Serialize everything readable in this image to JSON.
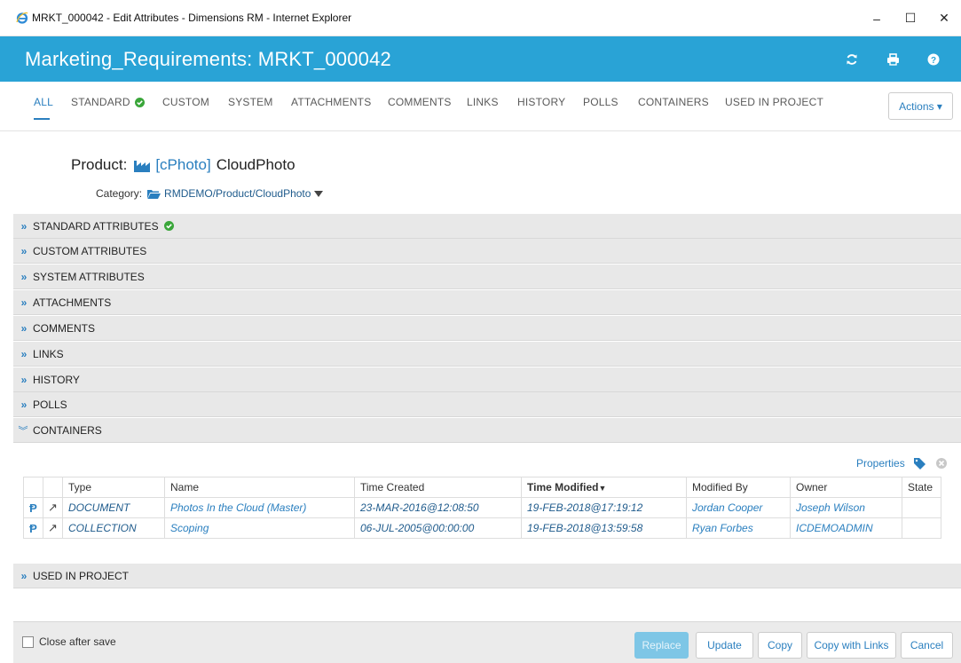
{
  "window": {
    "title": "MRKT_000042 - Edit Attributes - Dimensions RM - Internet Explorer",
    "minimize": "–",
    "maximize": "☐",
    "close": "✕"
  },
  "header": {
    "title": "Marketing_Requirements: MRKT_000042",
    "icons": [
      "refresh-icon",
      "print-icon",
      "help-icon"
    ]
  },
  "tabs": {
    "all": "ALL",
    "standard": "STANDARD",
    "custom": "CUSTOM",
    "system": "SYSTEM",
    "attachments": "ATTACHMENTS",
    "comments": "COMMENTS",
    "links": "LINKS",
    "history": "HISTORY",
    "polls": "POLLS",
    "containers": "CONTAINERS",
    "used_in_project": "USED IN PROJECT",
    "actions": "Actions ▾"
  },
  "product": {
    "label": "Product:",
    "code": "[cPhoto]",
    "name": "CloudPhoto",
    "category_label": "Category:",
    "category_path": "RMDEMO/Product/CloudPhoto"
  },
  "sections": {
    "standard": "STANDARD ATTRIBUTES",
    "custom": "CUSTOM ATTRIBUTES",
    "system": "SYSTEM ATTRIBUTES",
    "attachments": "ATTACHMENTS",
    "comments": "COMMENTS",
    "links": "LINKS",
    "history": "HISTORY",
    "polls": "POLLS",
    "containers": "CONTAINERS",
    "used_in_project": "USED IN PROJECT"
  },
  "containers": {
    "properties_label": "Properties",
    "columns": {
      "type": "Type",
      "name": "Name",
      "time_created": "Time Created",
      "time_modified": "Time Modified",
      "modified_by": "Modified By",
      "owner": "Owner",
      "state": "State"
    },
    "rows": [
      {
        "type": "DOCUMENT",
        "name": "Photos In the Cloud (Master)",
        "created": "23-MAR-2016@12:08:50",
        "modified": "19-FEB-2018@17:19:12",
        "modified_by": "Jordan Cooper",
        "owner": "Joseph Wilson",
        "state": ""
      },
      {
        "type": "COLLECTION",
        "name": "Scoping",
        "created": "06-JUL-2005@00:00:00",
        "modified": "19-FEB-2018@13:59:58",
        "modified_by": "Ryan Forbes",
        "owner": "ICDEMOADMIN",
        "state": ""
      }
    ]
  },
  "footer": {
    "close_after_save": "Close after save",
    "replace": "Replace",
    "update": "Update",
    "copy": "Copy",
    "copy_with_links": "Copy with Links",
    "cancel": "Cancel"
  },
  "colors": {
    "header_blue": "#29a3d6",
    "link_blue": "#2a7fbf",
    "ok_green": "#3aa63a"
  }
}
